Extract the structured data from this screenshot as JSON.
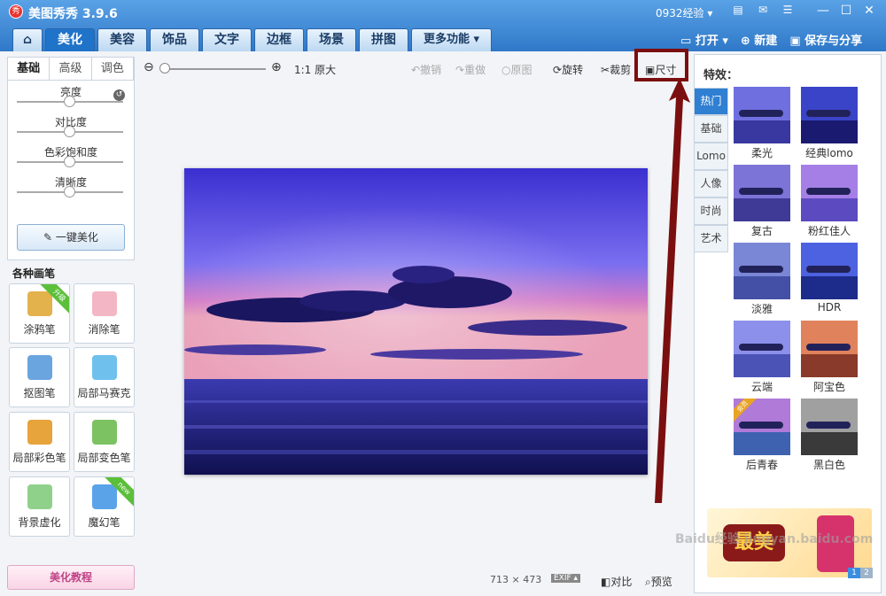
{
  "app": {
    "logo": "秀",
    "title": "美图秀秀 3.9.6",
    "user": "0932经验 ▾"
  },
  "window_controls": [
    "—",
    "☐",
    "✕"
  ],
  "tabs": [
    {
      "label": "⌂",
      "icon": "home-icon"
    },
    {
      "label": "美化"
    },
    {
      "label": "美容"
    },
    {
      "label": "饰品"
    },
    {
      "label": "文字"
    },
    {
      "label": "边框"
    },
    {
      "label": "场景"
    },
    {
      "label": "拼图"
    },
    {
      "label": "更多功能 ▾"
    }
  ],
  "right_actions": {
    "open": "打开 ▾",
    "new": "新建",
    "save": "保存与分享"
  },
  "left_panel": {
    "tabs": [
      "基础",
      "高级",
      "调色"
    ],
    "sliders": [
      {
        "label": "亮度",
        "value": 0.5
      },
      {
        "label": "对比度",
        "value": 0.5
      },
      {
        "label": "色彩饱和度",
        "value": 0.5
      },
      {
        "label": "清晰度",
        "value": 0.5
      }
    ],
    "auto_button": "一键美化"
  },
  "brushes": {
    "title": "各种画笔",
    "items": [
      {
        "label": "涂鸦笔",
        "badge": "升级",
        "color": "#e3b24c"
      },
      {
        "label": "消除笔",
        "badge": "",
        "color": "#f3b6c4"
      },
      {
        "label": "抠图笔",
        "badge": "",
        "color": "#6aa5df"
      },
      {
        "label": "局部马赛克",
        "badge": "",
        "color": "#6fc0ec"
      },
      {
        "label": "局部彩色笔",
        "badge": "",
        "color": "#e7a33c"
      },
      {
        "label": "局部变色笔",
        "badge": "",
        "color": "#7cc262"
      },
      {
        "label": "背景虚化",
        "badge": "",
        "color": "#8fd18a"
      },
      {
        "label": "魔幻笔",
        "badge": "new",
        "color": "#5aa3e8"
      }
    ]
  },
  "tutorial": "美化教程",
  "toolbar": {
    "zoom_out": "⊖",
    "zoom_in": "⊕",
    "ratio": "1:1 原大",
    "undo": "撤销",
    "redo": "重做",
    "original": "原图",
    "rotate": "旋转",
    "crop": "裁剪",
    "size": "尺寸"
  },
  "status": {
    "dimensions": "713 × 473",
    "exif": "EXIF ▴",
    "compare": "对比",
    "preview": "预览"
  },
  "effects": {
    "title": "特效：",
    "tabs": [
      "热门",
      "基础",
      "Lomo",
      "人像",
      "时尚",
      "艺术"
    ],
    "items": [
      {
        "label": "柔光",
        "sky": "#6f6fe0",
        "sea": "#3838a0"
      },
      {
        "label": "经典lomo",
        "sky": "#3a44c8",
        "sea": "#1a1a70"
      },
      {
        "label": "复古",
        "sky": "#7d74d8",
        "sea": "#3e3a95"
      },
      {
        "label": "粉红佳人",
        "sky": "#a57fe6",
        "sea": "#5c4ac0"
      },
      {
        "label": "淡雅",
        "sky": "#7a86d6",
        "sea": "#4450a5"
      },
      {
        "label": "HDR",
        "sky": "#4c62e0",
        "sea": "#1d2b8a"
      },
      {
        "label": "云端",
        "sky": "#8c90ea",
        "sea": "#4b53b6"
      },
      {
        "label": "阿宝色",
        "sky": "#e0825c",
        "sea": "#8a3a2a"
      },
      {
        "label": "后青春",
        "sky": "#b07ad8",
        "sea": "#3e62b0",
        "badge": "会员"
      },
      {
        "label": "黑白色",
        "sky": "#a0a0a0",
        "sea": "#3a3a3a"
      }
    ]
  },
  "ad": {
    "text": "最美",
    "pager": [
      "1",
      "2"
    ]
  },
  "watermark": "Baidu经验 jingyan.baidu.com"
}
